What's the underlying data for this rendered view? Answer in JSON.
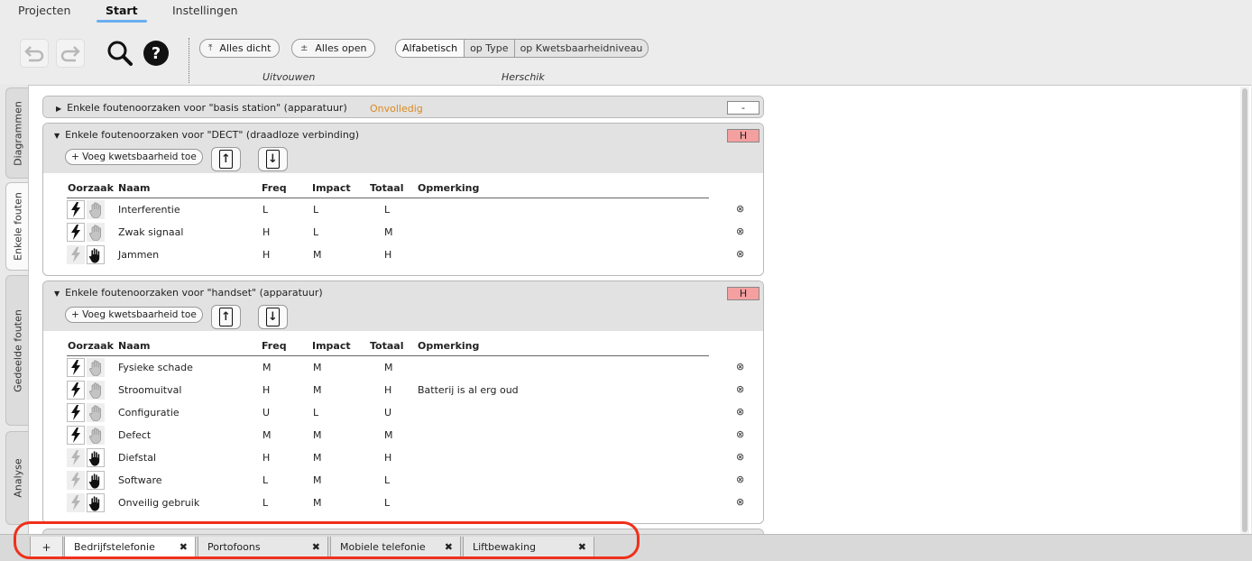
{
  "menu": {
    "tabs": [
      "Projecten",
      "Start",
      "Instellingen"
    ]
  },
  "toolbar": {
    "collapse_all": "Alles dicht",
    "expand_all": "Alles open",
    "sort_options": [
      "Alfabetisch",
      "op Type",
      "op Kwetsbaarheidniveau"
    ],
    "group_expand": "Uitvouwen",
    "group_sort": "Herschik"
  },
  "sidebar_tabs": [
    "Diagrammen",
    "Enkele fouten",
    "Gedeelde fouten",
    "Analyse"
  ],
  "colors": {
    "accent": "#6aaef0",
    "warning": "#d98a1f",
    "level_high": "#f4a0a0",
    "highlight": "#f0301b"
  },
  "panels": [
    {
      "title": "Enkele foutenoorzaken voor \"basis station\" (apparatuur)",
      "status": "Onvolledig",
      "level": "-"
    },
    {
      "title": "Enkele foutenoorzaken voor \"DECT\" (draadloze verbinding)",
      "level": "H",
      "add_label": "+ Voeg kwetsbaarheid toe",
      "columns": [
        "Oorzaak",
        "Naam",
        "Freq",
        "Impact",
        "Totaal",
        "Opmerking"
      ],
      "rows": [
        {
          "cause": "lightning",
          "name": "Interferentie",
          "freq": "L",
          "impact": "L",
          "total": "L",
          "remark": ""
        },
        {
          "cause": "lightning",
          "name": "Zwak signaal",
          "freq": "H",
          "impact": "L",
          "total": "M",
          "remark": ""
        },
        {
          "cause": "hand",
          "name": "Jammen",
          "freq": "H",
          "impact": "M",
          "total": "H",
          "remark": ""
        }
      ]
    },
    {
      "title": "Enkele foutenoorzaken voor \"handset\" (apparatuur)",
      "level": "H",
      "add_label": "+ Voeg kwetsbaarheid toe",
      "columns": [
        "Oorzaak",
        "Naam",
        "Freq",
        "Impact",
        "Totaal",
        "Opmerking"
      ],
      "rows": [
        {
          "cause": "lightning",
          "name": "Fysieke schade",
          "freq": "M",
          "impact": "M",
          "total": "M",
          "remark": ""
        },
        {
          "cause": "lightning",
          "name": "Stroomuitval",
          "freq": "H",
          "impact": "M",
          "total": "H",
          "remark": "Batterij is al erg oud"
        },
        {
          "cause": "lightning",
          "name": "Configuratie",
          "freq": "U",
          "impact": "L",
          "total": "U",
          "remark": ""
        },
        {
          "cause": "lightning",
          "name": "Defect",
          "freq": "M",
          "impact": "M",
          "total": "M",
          "remark": ""
        },
        {
          "cause": "hand",
          "name": "Diefstal",
          "freq": "H",
          "impact": "M",
          "total": "H",
          "remark": ""
        },
        {
          "cause": "hand",
          "name": "Software",
          "freq": "L",
          "impact": "M",
          "total": "L",
          "remark": ""
        },
        {
          "cause": "hand",
          "name": "Onveilig gebruik",
          "freq": "L",
          "impact": "M",
          "total": "L",
          "remark": ""
        }
      ]
    }
  ],
  "bottom_tabs": [
    {
      "label": "Bedrijfstelefonie",
      "active": true
    },
    {
      "label": "Portofoons",
      "active": false
    },
    {
      "label": "Mobiele telefonie",
      "active": false
    },
    {
      "label": "Liftbewaking",
      "active": false
    }
  ],
  "icons": {
    "undo": "undo-icon",
    "redo": "redo-icon",
    "search": "search-icon",
    "help": "help-icon",
    "delete": "⊗",
    "close_tab": "✖",
    "add_tab": "+"
  }
}
